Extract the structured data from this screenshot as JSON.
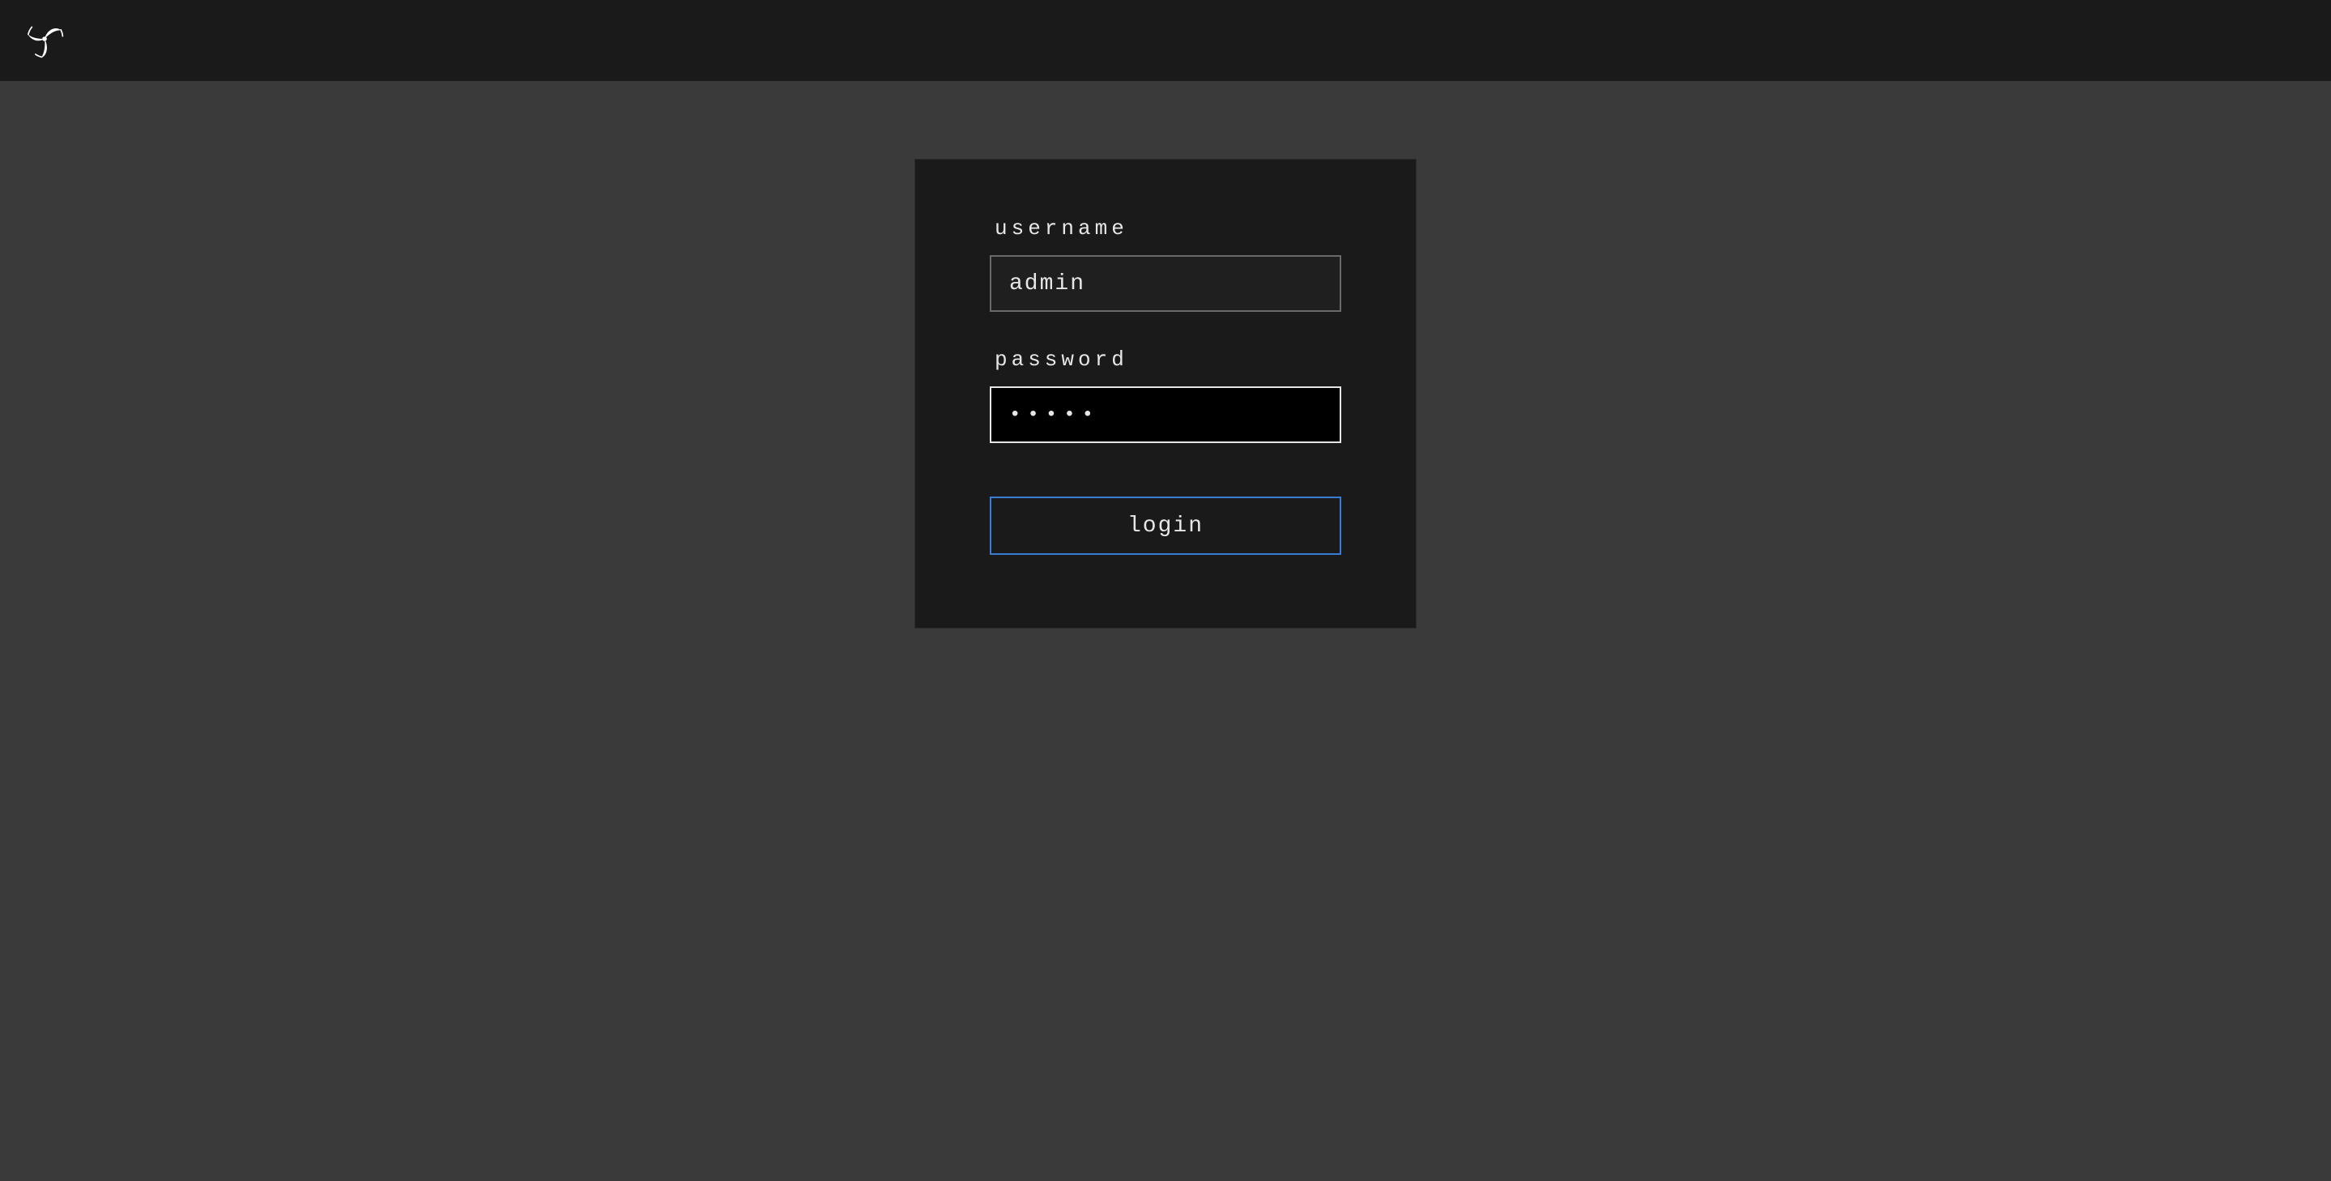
{
  "header": {
    "logo_alt": "concourse-logo"
  },
  "login": {
    "username_label": "username",
    "username_value": "admin",
    "password_label": "password",
    "password_value": "•••••",
    "button_label": "login"
  },
  "colors": {
    "bg": "#3a3a3a",
    "panel": "#1a1a1a",
    "accent": "#3a7bd5",
    "text": "#e6e6e6",
    "border_muted": "#6a6a6a"
  }
}
